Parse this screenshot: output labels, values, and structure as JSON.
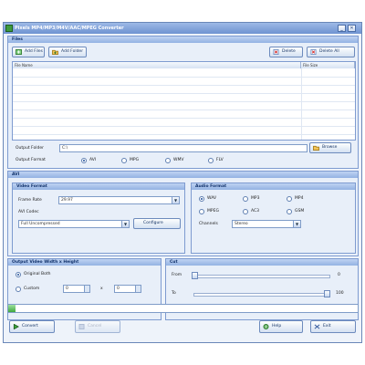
{
  "window": {
    "title": "Pixels MP4/MP3/M4V/AAC/MPEG Converter"
  },
  "files": {
    "section_title": "Files",
    "add_files": "Add Files",
    "add_folder": "Add Folder",
    "delete": "Delete",
    "delete_all": "Delete All",
    "columns": [
      "File Name",
      "File Size"
    ],
    "output_folder_label": "Output Folder",
    "output_folder_value": "C:\\",
    "browse": "Browse",
    "output_format_label": "Output Format",
    "formats": [
      "AVI",
      "MPG",
      "WMV",
      "FLV"
    ],
    "selected_format": "AVI"
  },
  "avi": {
    "section_title": "AVI",
    "video_format_title": "Video Format",
    "frame_rate_label": "Frame Rate",
    "frame_rate_value": "29.97",
    "avi_codec_label": "AVI Codec",
    "avi_codec_value": "Full Uncompressed",
    "configure": "Configure",
    "audio_format_title": "Audio Format",
    "audio_options": [
      "WAV",
      "MP3",
      "MP4",
      "MPEG",
      "AC3",
      "GSM"
    ],
    "selected_audio": "WAV",
    "channels_label": "Channels",
    "channels_value": "Stereo"
  },
  "size": {
    "section_title": "Output Video Width x Height",
    "original_label": "Original Both",
    "custom_label": "Custom",
    "width_value": "0",
    "x_label": "x",
    "height_value": "0"
  },
  "cut": {
    "section_title": "Cut",
    "from_label": "From",
    "from_value": "0",
    "to_label": "To",
    "to_value": "100"
  },
  "progress": {
    "value": 0.02
  },
  "bottom": {
    "convert": "Convert",
    "cancel": "Cancel",
    "help": "Help",
    "exit": "Exit"
  }
}
